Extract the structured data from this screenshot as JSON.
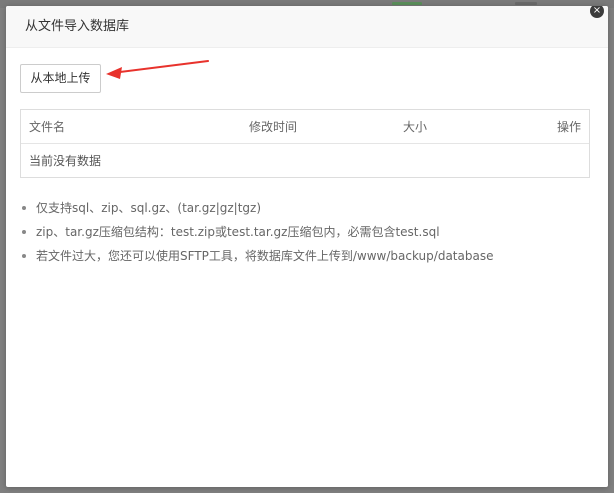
{
  "dialog": {
    "title": "从文件导入数据库",
    "close_label": "×"
  },
  "toolbar": {
    "upload_label": "从本地上传"
  },
  "table": {
    "columns": [
      "文件名",
      "修改时间",
      "大小",
      "操作"
    ],
    "empty_text": "当前没有数据"
  },
  "tips": [
    "仅支持sql、zip、sql.gz、(tar.gz|gz|tgz)",
    "zip、tar.gz压缩包结构：test.zip或test.tar.gz压缩包内，必需包含test.sql",
    "若文件过大，您还可以使用SFTP工具，将数据库文件上传到/www/backup/database"
  ],
  "colors": {
    "annotation_arrow": "#e8322c",
    "header_bg": "#f8f8f8",
    "border": "#dddddd"
  }
}
